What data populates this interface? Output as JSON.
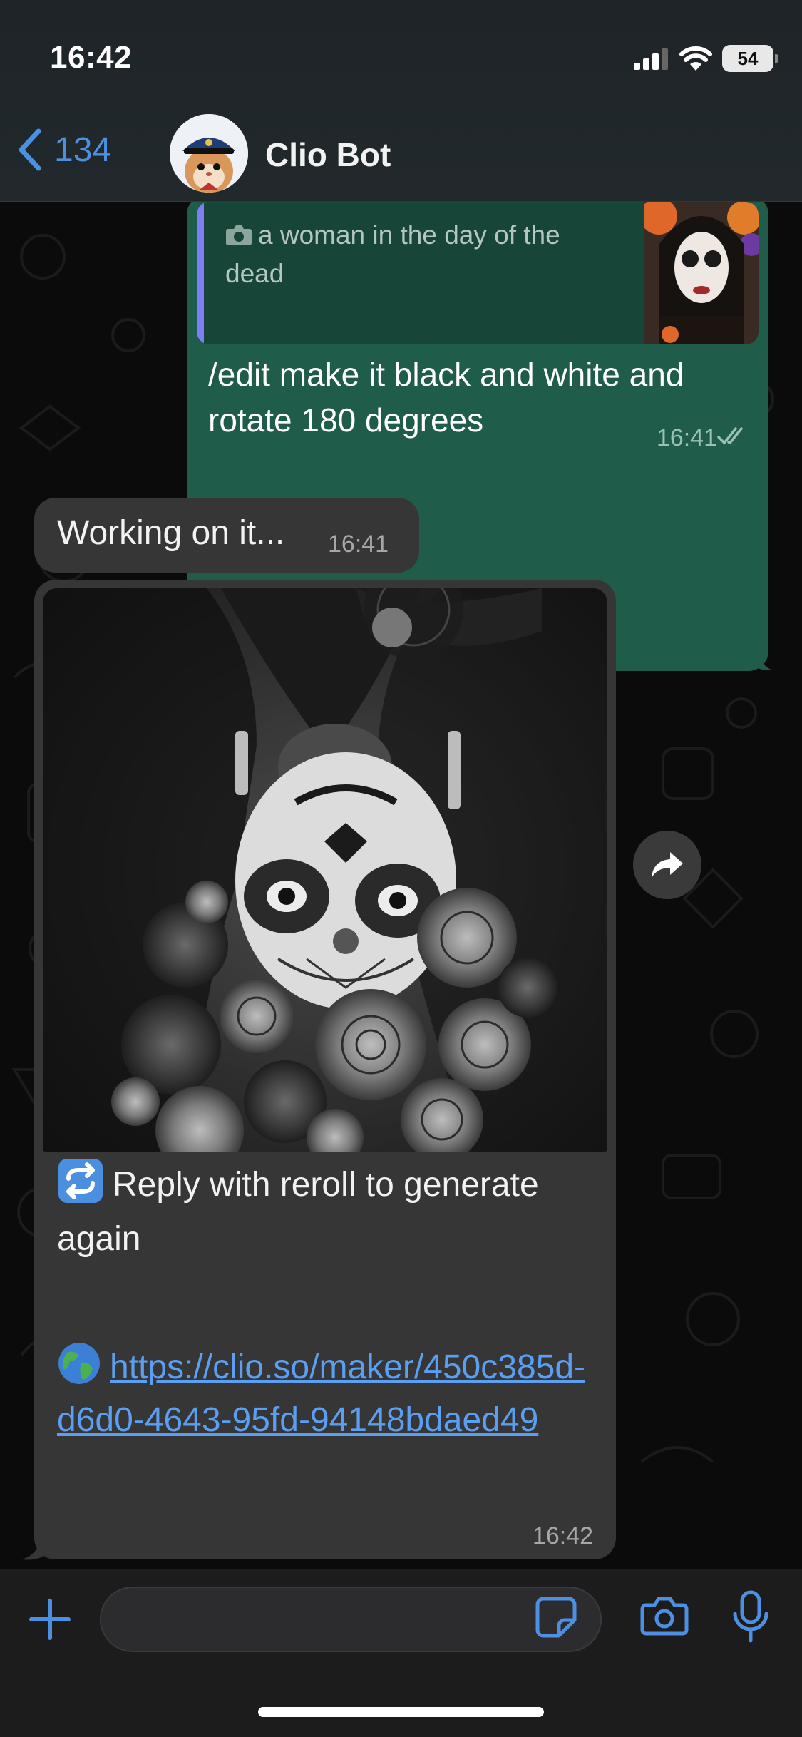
{
  "status_bar": {
    "time": "16:42",
    "battery_level": "54",
    "icons": [
      "cellular-signal-icon",
      "wifi-icon",
      "battery-icon"
    ]
  },
  "header": {
    "back_count": "134",
    "contact_name": "Clio Bot",
    "avatar": "hamster-avatar"
  },
  "messages": {
    "outgoing": {
      "quote_text": "a woman in the day of the dead",
      "text": "/edit make it black and white and rotate 180 degrees",
      "time": "16:41",
      "status": "read"
    },
    "working": {
      "text": "Working on it...",
      "time": "16:41"
    },
    "result": {
      "reroll_text": "Reply with reroll to generate again",
      "reroll_emoji": "repeat-icon",
      "link_emoji": "globe-icon",
      "link": "https://clio.so/maker/450c385d-d6d0-4643-95fd-94148bdaed49",
      "time": "16:42"
    }
  },
  "colors": {
    "outgoing_bubble": "#1f5c4a",
    "incoming_bubble": "#363636",
    "accent": "#4d8fe0",
    "link": "#5a9ff2",
    "quote_bar": "#7f7ef7"
  }
}
